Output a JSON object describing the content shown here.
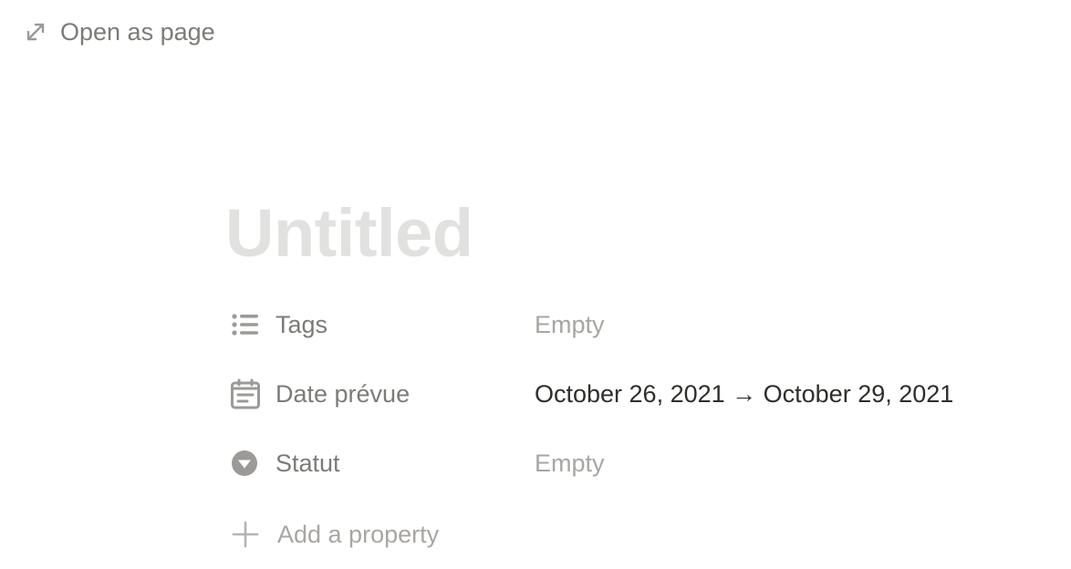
{
  "topbar": {
    "open_as_page_label": "Open as page",
    "icon": "expand-diagonal-icon"
  },
  "page": {
    "title": "Untitled",
    "title_color": "#e1e1e0"
  },
  "properties": [
    {
      "label": "Tags",
      "icon": "list-icon",
      "value": "Empty",
      "empty": true
    },
    {
      "label": "Date prévue",
      "icon": "calendar-icon",
      "value": "October 26, 2021 → October 29, 2021",
      "empty": false
    },
    {
      "label": "Statut",
      "icon": "select-dropdown-icon",
      "value": "Empty",
      "empty": true
    }
  ],
  "add_property": {
    "label": "Add a property",
    "icon": "plus-icon"
  },
  "colors": {
    "label_gray": "#7d7b77",
    "placeholder_gray": "#a8a6a2",
    "text_dark": "#2f2e2b"
  }
}
